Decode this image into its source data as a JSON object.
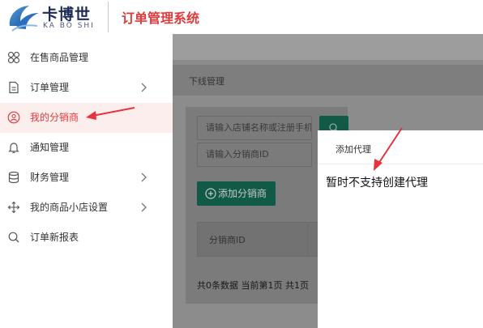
{
  "header": {
    "logo_cn": "卡博世",
    "logo_en": "KA BO SHI",
    "app_title": "订单管理系统",
    "brand_color": "#e03a3a"
  },
  "sidebar": {
    "items": [
      {
        "label": "在售商品管理",
        "icon": "grid-icon",
        "active": false,
        "has_submenu": false
      },
      {
        "label": "订单管理",
        "icon": "document-icon",
        "active": false,
        "has_submenu": true
      },
      {
        "label": "我的分销商",
        "icon": "user-circle-icon",
        "active": true,
        "has_submenu": false
      },
      {
        "label": "通知管理",
        "icon": "bell-icon",
        "active": false,
        "has_submenu": false
      },
      {
        "label": "财务管理",
        "icon": "database-icon",
        "active": false,
        "has_submenu": true
      },
      {
        "label": "我的商品小店设置",
        "icon": "move-arrows-icon",
        "active": false,
        "has_submenu": true
      },
      {
        "label": "订单新报表",
        "icon": "search-icon",
        "active": false,
        "has_submenu": false
      }
    ]
  },
  "main": {
    "breadcrumb": "下线管理",
    "search": {
      "store_placeholder": "请输入店铺名称或注册手机号",
      "distributor_placeholder": "请输入分销商ID"
    },
    "add_button_label": "添加分销商",
    "table": {
      "columns": [
        "分销商ID"
      ]
    },
    "pagination": "共0条数据 当前第1页 共1页"
  },
  "modal": {
    "title": "添加代理",
    "message": "暂时不支持创建代理"
  },
  "colors": {
    "overlay": "#8c8c8c",
    "button_dark_green": "#115a48",
    "active_bg": "#fdeeee",
    "annotation_arrow": "#e8323c"
  }
}
